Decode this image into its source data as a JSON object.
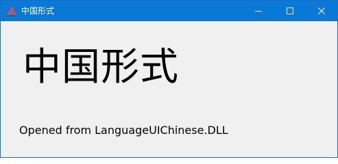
{
  "window": {
    "title": "中国形式",
    "icon": "app-triangle-icon",
    "controls": {
      "minimize_icon": "minimize-icon",
      "maximize_icon": "maximize-icon",
      "close_icon": "close-icon"
    },
    "colors": {
      "titlebar": "#0a78d7",
      "title_text": "#ffffff",
      "client_background": "#f0f0f0",
      "text": "#000000"
    }
  },
  "content": {
    "heading": "中国形式",
    "message": "Opened from LanguageUIChinese.DLL"
  }
}
